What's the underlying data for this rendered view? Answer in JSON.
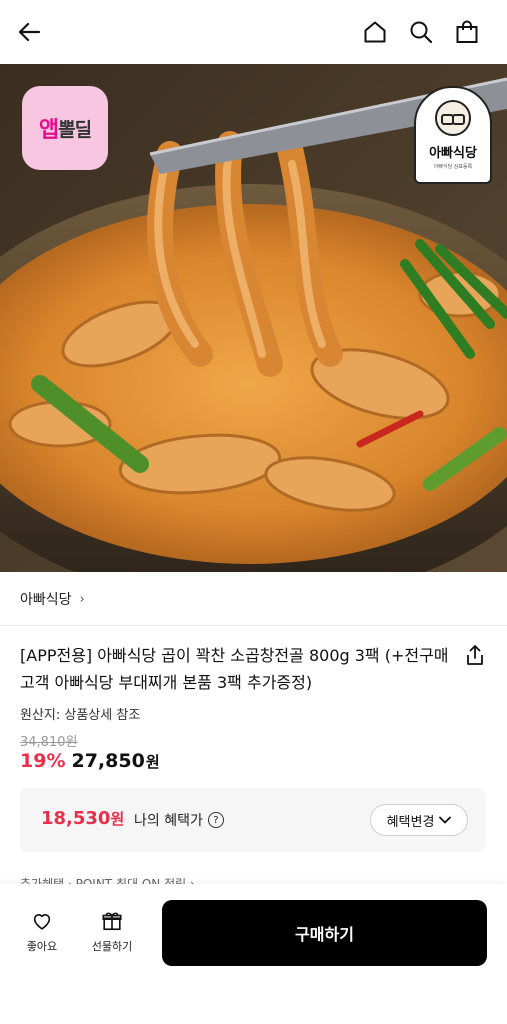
{
  "header": {
    "back_icon": "arrow-left-icon",
    "home_icon": "home-icon",
    "search_icon": "search-icon",
    "cart_icon": "shopping-bag-icon"
  },
  "hero": {
    "badge": {
      "part1": "앱",
      "part2": "뽈딜",
      "color": "#e0128a",
      "background": "#f8c6e0"
    },
    "brand_logo": {
      "name": "아빠식당",
      "sub": "아빠식당 상표등록"
    }
  },
  "store": {
    "name": "아빠식당",
    "chevron": "›"
  },
  "product": {
    "title": "[APP전용] 아빠식당 곱이 꽉찬 소곱창전골 800g 3팩 (+전구매고객 아빠식당 부대찌개 본품 3팩 추가증정)",
    "origin": "원산지: 상품상세 참조",
    "original_price": "34,810원",
    "discount_rate": "19%",
    "sale_price": "27,850",
    "sale_unit": "원"
  },
  "benefit": {
    "price": "18,530",
    "unit": "원",
    "label": "나의 혜택가",
    "help": "?",
    "button": "혜택변경",
    "button_chevron": "⌄"
  },
  "cut_text": "추가혜택 · POINT 최대 ON 적립 ›",
  "bottom_bar": {
    "like_label": "좋아요",
    "gift_label": "선물하기",
    "buy_label": "구매하기"
  },
  "colors": {
    "accent": "#e9304a",
    "buy_button": "#000000",
    "benefit_bg": "#f6f6f7"
  }
}
